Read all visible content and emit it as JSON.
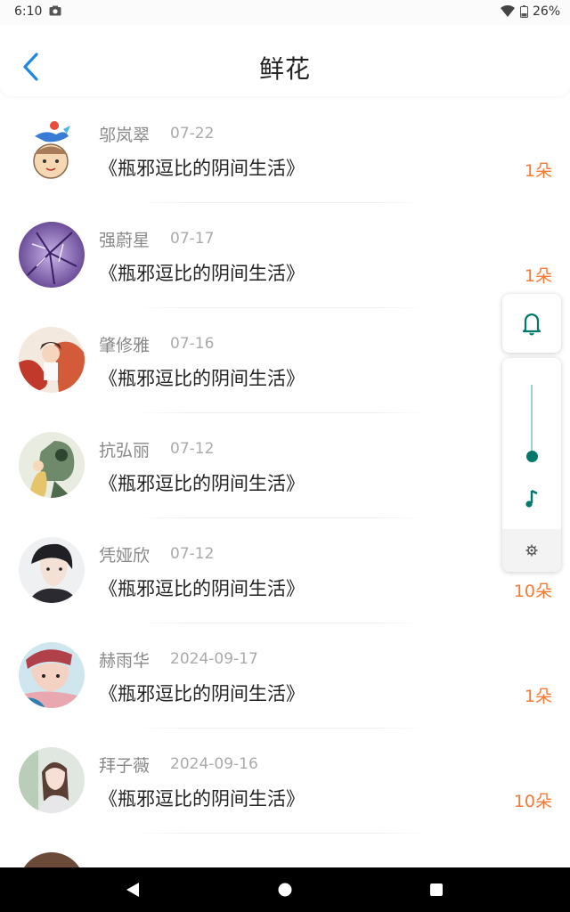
{
  "status": {
    "time": "6:10",
    "battery": "26%"
  },
  "header": {
    "title": "鲜花"
  },
  "items": [
    {
      "name": "邬岚翠",
      "date": "07-22",
      "book": "《瓶邪逗比的阴间生活》",
      "count": "1朵"
    },
    {
      "name": "强蔚星",
      "date": "07-17",
      "book": "《瓶邪逗比的阴间生活》",
      "count": "1朵"
    },
    {
      "name": "肇修雅",
      "date": "07-16",
      "book": "《瓶邪逗比的阴间生活》",
      "count": ""
    },
    {
      "name": "抗弘丽",
      "date": "07-12",
      "book": "《瓶邪逗比的阴间生活》",
      "count": ""
    },
    {
      "name": "凭娅欣",
      "date": "07-12",
      "book": "《瓶邪逗比的阴间生活》",
      "count": "10朵"
    },
    {
      "name": "赫雨华",
      "date": "2024-09-17",
      "book": "《瓶邪逗比的阴间生活》",
      "count": "1朵"
    },
    {
      "name": "拜子薇",
      "date": "2024-09-16",
      "book": "《瓶邪逗比的阴间生活》",
      "count": "10朵"
    }
  ],
  "colors": {
    "accent": "#1e88e5",
    "count": "#f27b37",
    "volume": "#00796b"
  },
  "icons": {
    "back": "chevron-left-icon",
    "bell": "bell-icon",
    "music": "music-note-icon",
    "settings": "gear-icon",
    "nav_back": "triangle-back-icon",
    "nav_home": "circle-home-icon",
    "nav_recents": "square-recents-icon"
  }
}
